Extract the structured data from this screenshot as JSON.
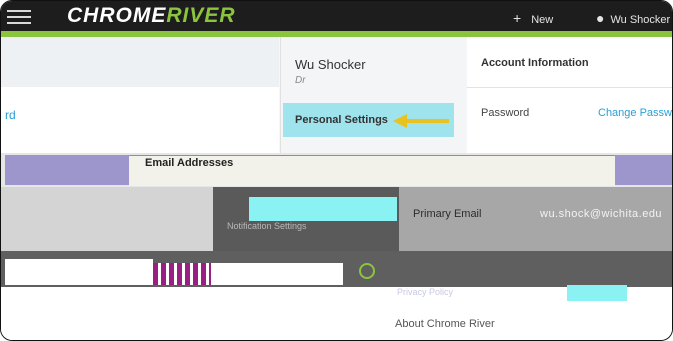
{
  "topbar": {
    "logo_part1": "CHROME",
    "logo_part2": "RIVER",
    "new_label": "New",
    "user_label": "Wu Shocker",
    "accent_color": "#8bc53f"
  },
  "left_panel": {
    "link_text": "rd"
  },
  "profile_menu": {
    "name": "Wu Shocker",
    "title": "Dr",
    "selected_item": "Personal Settings",
    "notification_item": "Notification Settings",
    "privacy_item": "Privacy Policy",
    "about_item": "About Chrome River"
  },
  "account_info": {
    "heading": "Account Information",
    "password_label": "Password",
    "change_password_link": "Change Passwo"
  },
  "email": {
    "heading": "Email Addresses",
    "primary_label": "Primary Email",
    "primary_value": "wu.shock@wichita.edu"
  },
  "icons": {
    "menu": "hamburger-icon",
    "new": "plus-icon",
    "user": "user-icon",
    "annotation": "arrow-icon",
    "circle": "circle-icon"
  }
}
